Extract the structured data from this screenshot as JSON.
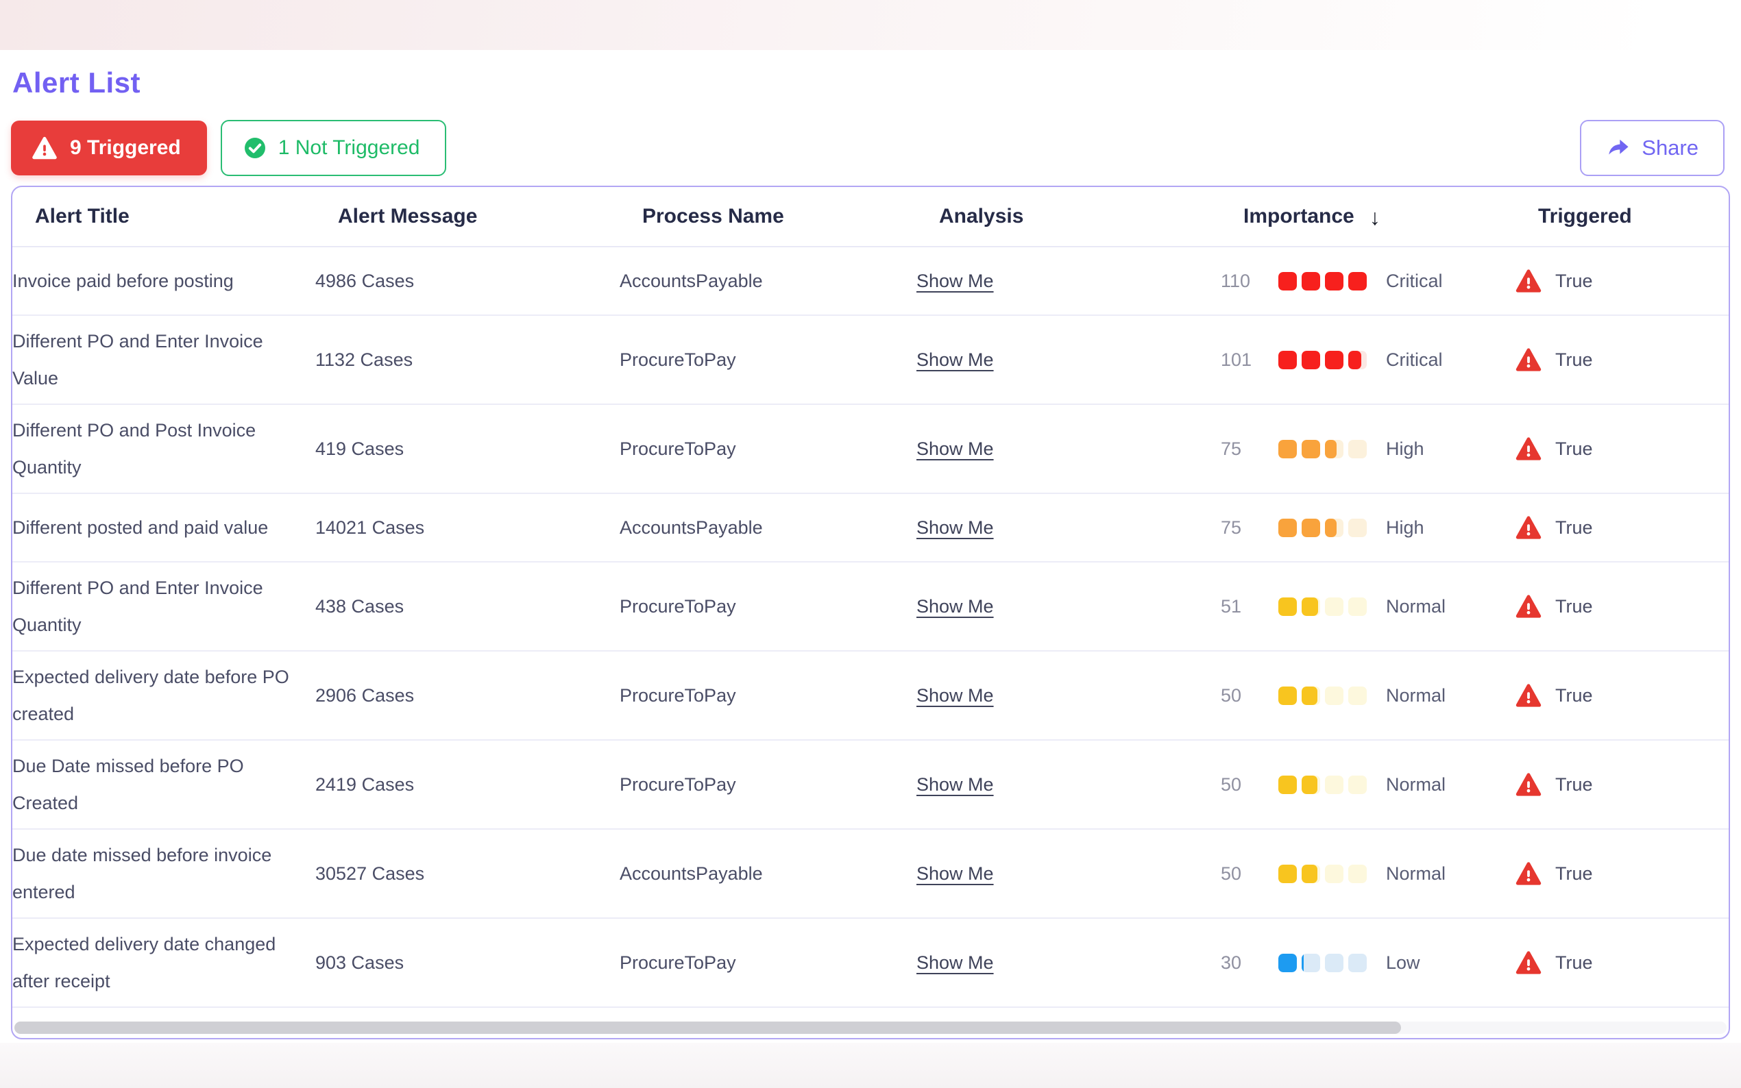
{
  "header": {
    "title": "Alert List"
  },
  "summary": {
    "triggered": {
      "label": "9 Triggered",
      "color": "#e83d3b"
    },
    "not_triggered": {
      "label": "1 Not Triggered",
      "color": "#1ebb67"
    }
  },
  "actions": {
    "share": {
      "label": "Share",
      "color": "#7166f2"
    }
  },
  "table": {
    "columns": {
      "title": "Alert Title",
      "message": "Alert Message",
      "process": "Process Name",
      "analysis": "Analysis",
      "importance": "Importance",
      "triggered": "Triggered"
    },
    "sort": {
      "column": "Importance",
      "direction": "desc",
      "indicator": "↓"
    },
    "analysis_link_label": "Show Me",
    "levels": {
      "Critical": {
        "fill": "#f7201d",
        "track": "#fbe7e3"
      },
      "High": {
        "fill": "#f9a33c",
        "track": "#fcf1dc"
      },
      "Normal": {
        "fill": "#f8c51f",
        "track": "#fdf8dd"
      },
      "Low": {
        "fill": "#1d9bf1",
        "track": "#dbeaf7"
      }
    },
    "rows": [
      {
        "title": "Invoice paid before posting",
        "message": "4986 Cases",
        "process": "AccountsPayable",
        "importance": {
          "value": "110",
          "level": "Critical",
          "segments": [
            1,
            1,
            1,
            1
          ]
        },
        "triggered": "True"
      },
      {
        "title": "Different PO and Enter Invoice Value",
        "message": "1132 Cases",
        "process": "ProcureToPay",
        "importance": {
          "value": "101",
          "level": "Critical",
          "segments": [
            1,
            1,
            1,
            0.72
          ]
        },
        "triggered": "True"
      },
      {
        "title": "Different PO and Post Invoice Quantity",
        "message": "419 Cases",
        "process": "ProcureToPay",
        "importance": {
          "value": "75",
          "level": "High",
          "segments": [
            1,
            1,
            0.62,
            0
          ]
        },
        "triggered": "True"
      },
      {
        "title": "Different posted and paid value",
        "message": "14021 Cases",
        "process": "AccountsPayable",
        "importance": {
          "value": "75",
          "level": "High",
          "segments": [
            1,
            1,
            0.62,
            0
          ]
        },
        "triggered": "True"
      },
      {
        "title": "Different PO and Enter Invoice Quantity",
        "message": "438 Cases",
        "process": "ProcureToPay",
        "importance": {
          "value": "51",
          "level": "Normal",
          "segments": [
            1,
            0.88,
            0,
            0
          ]
        },
        "triggered": "True"
      },
      {
        "title": "Expected delivery date before PO created",
        "message": "2906 Cases",
        "process": "ProcureToPay",
        "importance": {
          "value": "50",
          "level": "Normal",
          "segments": [
            1,
            0.85,
            0,
            0
          ]
        },
        "triggered": "True"
      },
      {
        "title": "Due Date missed before PO Created",
        "message": "2419 Cases",
        "process": "ProcureToPay",
        "importance": {
          "value": "50",
          "level": "Normal",
          "segments": [
            1,
            0.85,
            0,
            0
          ]
        },
        "triggered": "True"
      },
      {
        "title": "Due date missed before invoice entered",
        "message": "30527 Cases",
        "process": "AccountsPayable",
        "importance": {
          "value": "50",
          "level": "Normal",
          "segments": [
            1,
            0.85,
            0,
            0
          ]
        },
        "triggered": "True"
      },
      {
        "title": "Expected delivery date changed after receipt",
        "message": "903 Cases",
        "process": "ProcureToPay",
        "importance": {
          "value": "30",
          "level": "Low",
          "segments": [
            1,
            0.12,
            0,
            0
          ]
        },
        "triggered": "True"
      }
    ],
    "row_warning_color": "#e6372f"
  },
  "scrollbar": {
    "thumb_fraction": 0.81
  }
}
